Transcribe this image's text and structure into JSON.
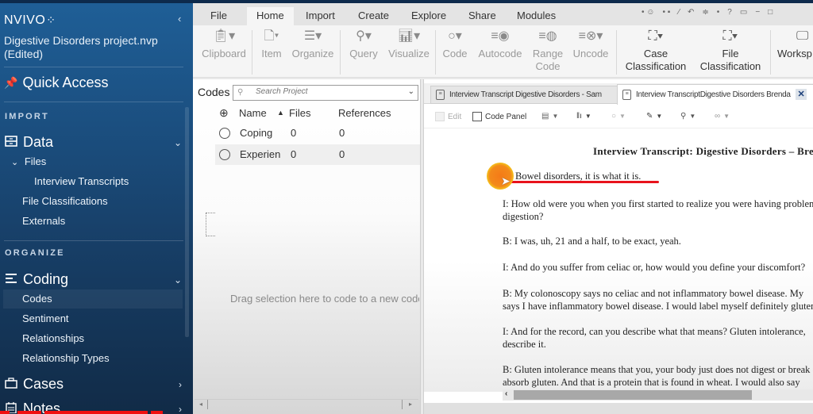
{
  "app": {
    "logo": "NVIVO",
    "logo_dots": "⁘",
    "project_name": "Digestive Disorders project.nvp",
    "project_status": "(Edited)",
    "collapse_glyph": "‹"
  },
  "sidebar": {
    "quick_access": "Quick Access",
    "sections": {
      "import": "IMPORT",
      "organize": "ORGANIZE"
    },
    "data": {
      "label": "Data",
      "files": "Files",
      "interview_transcripts": "Interview Transcripts",
      "file_classifications": "File Classifications",
      "externals": "Externals"
    },
    "coding": {
      "label": "Coding",
      "codes": "Codes",
      "sentiment": "Sentiment",
      "relationships": "Relationships",
      "relationship_types": "Relationship Types"
    },
    "cases": "Cases",
    "notes": "Notes"
  },
  "ribbon": {
    "tabs": [
      "File",
      "Home",
      "Import",
      "Create",
      "Explore",
      "Share",
      "Modules"
    ],
    "active_tab": "Home",
    "buttons": {
      "clipboard": "Clipboard",
      "item": "Item",
      "organize": "Organize",
      "query": "Query",
      "visualize": "Visualize",
      "code": "Code",
      "autocode": "Autocode",
      "range_code_1": "Range",
      "range_code_2": "Code",
      "uncode": "Uncode",
      "case_class_1": "Case",
      "case_class_2": "Classification",
      "file_class_1": "File",
      "file_class_2": "Classification",
      "workspace": "Worksp"
    }
  },
  "codes_panel": {
    "title": "Codes",
    "search_placeholder": "Search Project",
    "columns": {
      "name": "Name",
      "files": "Files",
      "references": "References"
    },
    "rows": [
      {
        "name": "Coping",
        "files": "0",
        "references": "0"
      },
      {
        "name": "Experien",
        "files": "0",
        "references": "0"
      }
    ],
    "drag_hint": "Drag selection here to code to a new code"
  },
  "document": {
    "tabs": [
      {
        "label": "Interview Transcript Digestive Disorders - Sam",
        "active": false
      },
      {
        "label": "Interview TranscriptDigestive Disorders Brenda",
        "active": true
      }
    ],
    "toolbar": {
      "edit": "Edit",
      "code_panel": "Code Panel"
    },
    "title": "Interview Transcript: Digestive Disorders – Brenda",
    "paragraphs": [
      "Bowel disorders, it is what it is.",
      "I: How old were you when you first started to realize you were having problems with your",
      "digestion?",
      "B: I was, uh, 21 and a half, to be exact, yeah.",
      "I: And do you suffer from celiac or, how would you define your discomfort?",
      "B: My colonoscopy says no celiac and not inflammatory bowel disease. My",
      "says I have inflammatory bowel disease. I would label myself definitely gluten",
      "I: And for the record, can you describe what that means? Gluten intolerance,",
      "describe it.",
      "B: Gluten intolerance means that you, your body just does not digest or break down",
      "absorb gluten. And that is a protein that is found in wheat. I would also say"
    ]
  },
  "colors": {
    "sidebar_top": "#1f5f97",
    "sidebar_bottom": "#112b47",
    "annotation_red": "#e8131c",
    "cursor_orange": "#f47a18"
  }
}
